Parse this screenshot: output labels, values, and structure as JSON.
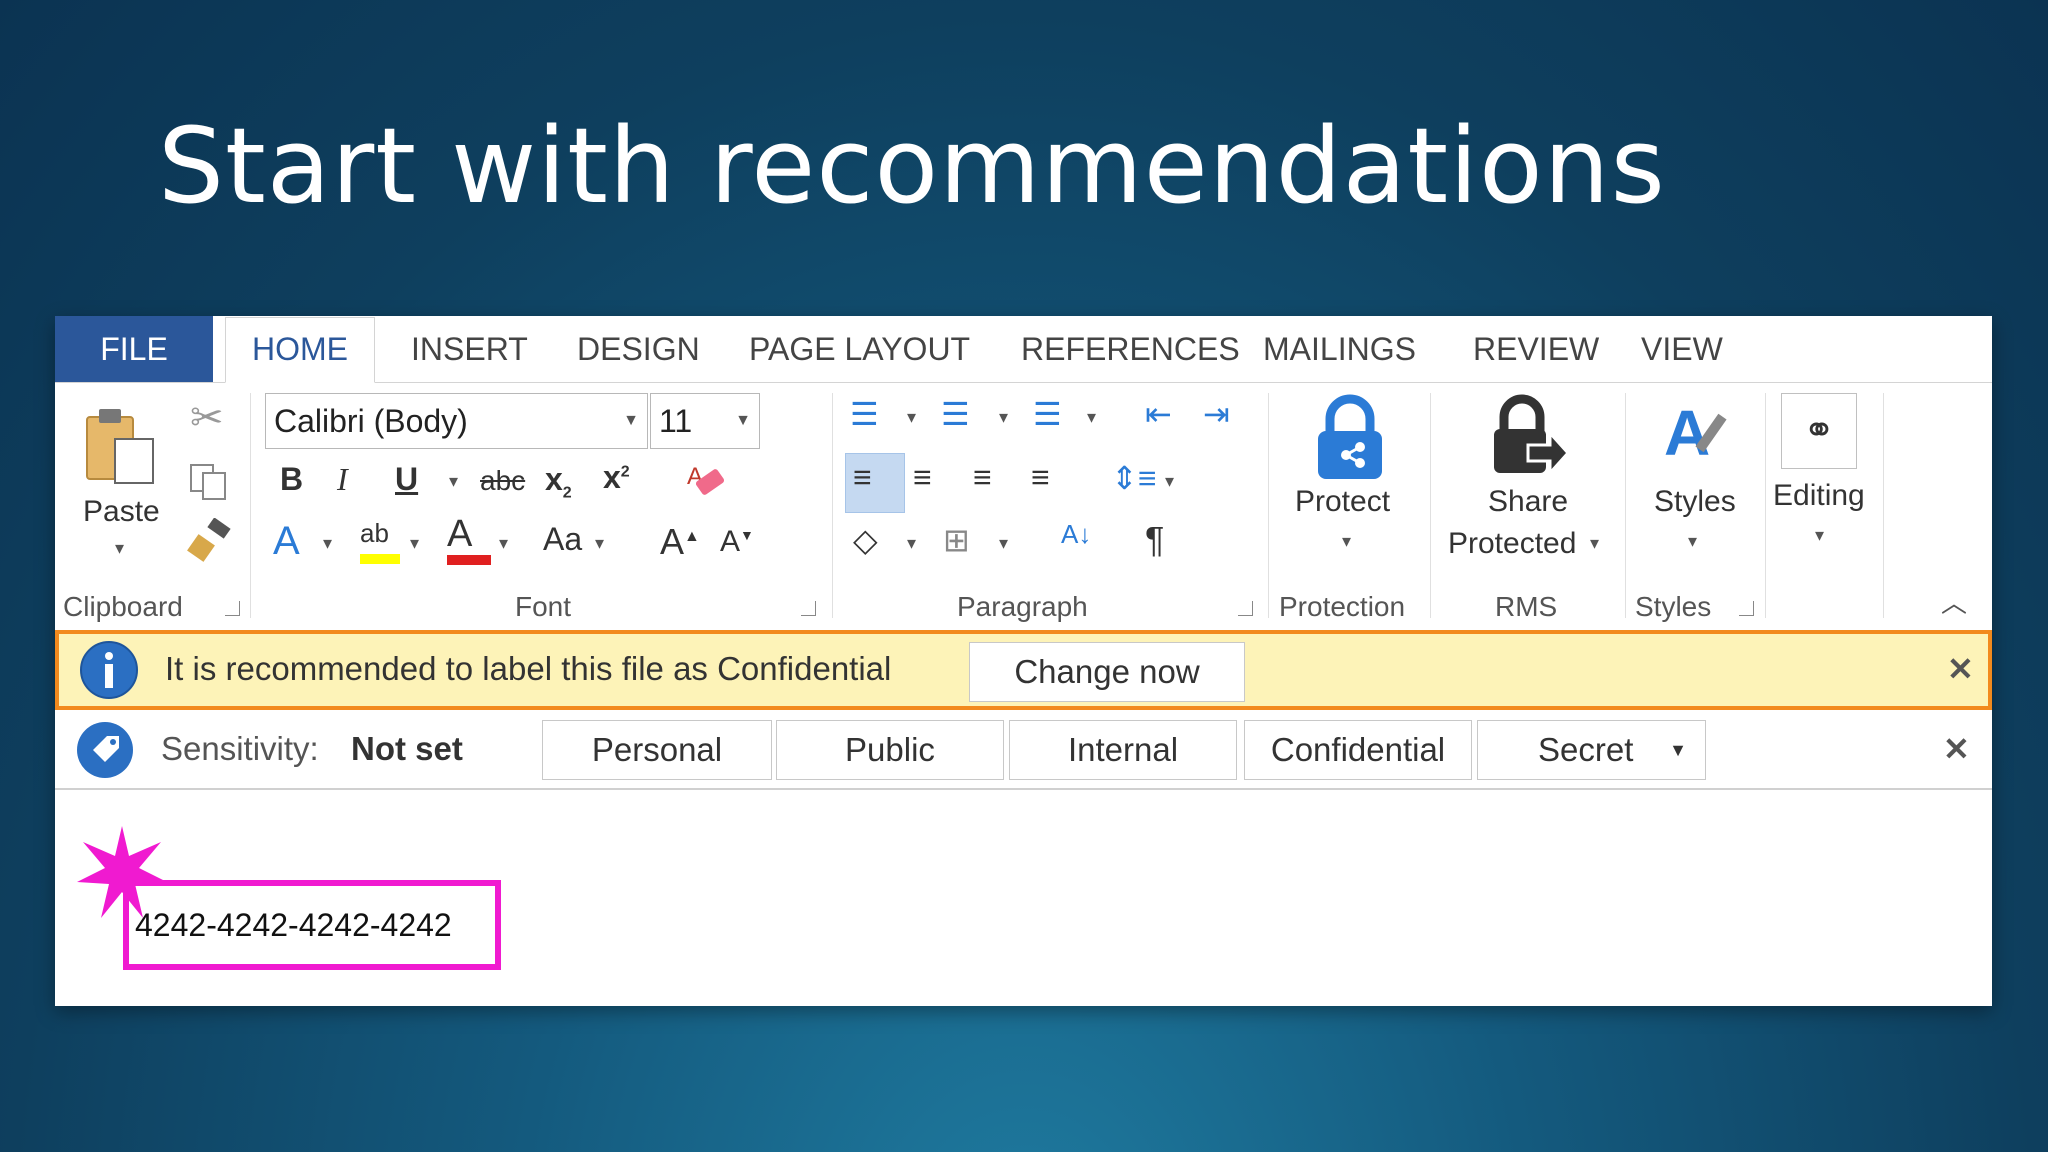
{
  "slide": {
    "title": "Start with recommendations"
  },
  "tabs": [
    "FILE",
    "HOME",
    "INSERT",
    "DESIGN",
    "PAGE LAYOUT",
    "REFERENCES",
    "MAILINGS",
    "REVIEW",
    "VIEW"
  ],
  "ribbon": {
    "clipboard": {
      "paste_label": "Paste",
      "group_label": "Clipboard"
    },
    "font": {
      "font_name": "Calibri (Body)",
      "font_size": "11",
      "group_label": "Font"
    },
    "paragraph": {
      "group_label": "Paragraph"
    },
    "protection": {
      "protect_label": "Protect",
      "group_label": "Protection"
    },
    "rms": {
      "share_label_1": "Share",
      "share_label_2": "Protected",
      "group_label": "RMS"
    },
    "styles": {
      "styles_label": "Styles",
      "group_label": "Styles"
    },
    "editing": {
      "editing_label": "Editing"
    }
  },
  "recommendation": {
    "message": "It is recommended to label this file as Confidential",
    "button": "Change now"
  },
  "sensitivity": {
    "label": "Sensitivity:",
    "value": "Not set",
    "options": [
      "Personal",
      "Public",
      "Internal",
      "Confidential",
      "Secret"
    ]
  },
  "document": {
    "text": "4242-4242-4242-4242"
  },
  "colors": {
    "accent": "#2b579a",
    "warning_border": "#f28a1e",
    "warning_bg": "#fdf3b8",
    "highlight": "#f01ad0"
  }
}
